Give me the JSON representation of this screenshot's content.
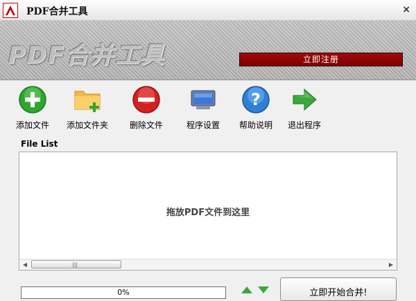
{
  "window": {
    "title": "PDF合并工具",
    "close_icon": "×"
  },
  "banner": {
    "logo_text": "PDF合并工具",
    "register_label": "立即注册"
  },
  "toolbar": {
    "items": [
      {
        "label": "添加文件",
        "icon": "plus-circle-icon"
      },
      {
        "label": "添加文件夹",
        "icon": "folder-add-icon"
      },
      {
        "label": "删除文件",
        "icon": "minus-circle-icon"
      },
      {
        "label": "程序设置",
        "icon": "monitor-icon"
      },
      {
        "label": "帮助说明",
        "icon": "help-icon"
      },
      {
        "label": "退出程序",
        "icon": "exit-arrow-icon"
      }
    ]
  },
  "file_list": {
    "label": "File List",
    "placeholder": "拖放PDF文件到这里",
    "scroll_left": "◀",
    "scroll_right": "▶",
    "scroll_grip": "|||"
  },
  "progress": {
    "value": 0,
    "text": "0%"
  },
  "start_button": {
    "label": "立即开始合并!"
  },
  "colors": {
    "accent_red": "#8b0000",
    "progress_green": "#4caf50"
  }
}
